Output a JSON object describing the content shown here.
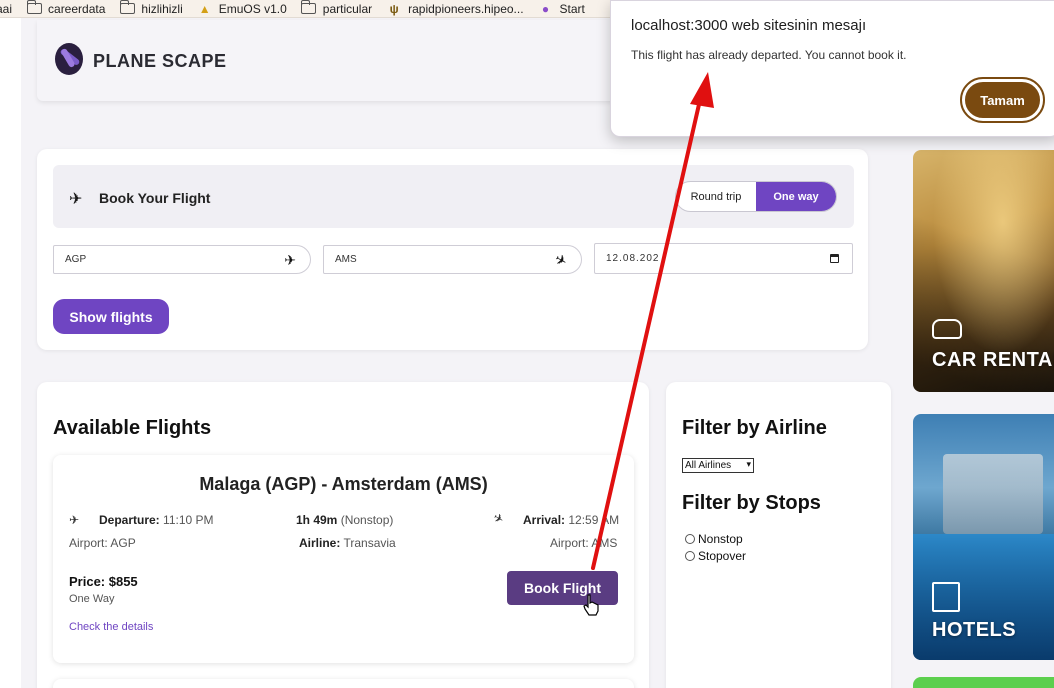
{
  "bookmarks": [
    {
      "label": "aai",
      "icon": "none"
    },
    {
      "label": "careerdata",
      "icon": "folder-icon"
    },
    {
      "label": "hizlihizli",
      "icon": "folder-icon"
    },
    {
      "label": "EmuOS v1.0",
      "icon": "emuos-icon"
    },
    {
      "label": "particular",
      "icon": "folder-icon"
    },
    {
      "label": "rapidpioneers.hipeo...",
      "icon": "rapidpioneers-icon"
    },
    {
      "label": "Start",
      "icon": "start-icon"
    }
  ],
  "header": {
    "brand": "PLANE SCAPE"
  },
  "booking": {
    "title": "Book Your Flight",
    "trip_types": [
      "Round trip",
      "One way"
    ],
    "active_trip_type": "One way",
    "from": "AGP",
    "to": "AMS",
    "date": "12.08.202",
    "show_button": "Show flights"
  },
  "flights": {
    "heading": "Available Flights",
    "items": [
      {
        "route": "Malaga (AGP) - Amsterdam (AMS)",
        "departure_label": "Departure:",
        "departure_time": "11:10 PM",
        "departure_airport": "Airport: AGP",
        "duration": "1h 49m",
        "stops": "(Nonstop)",
        "airline_label": "Airline:",
        "airline": "Transavia",
        "arrival_label": "Arrival:",
        "arrival_time": "12:59 AM",
        "arrival_airport": "Airport: AMS",
        "price": "Price: $855",
        "trip": "One Way",
        "details_link": "Check the details",
        "book_button": "Book Flight"
      }
    ]
  },
  "filters": {
    "airline_heading": "Filter by Airline",
    "airline_selected": "All Airlines",
    "stops_heading": "Filter by Stops",
    "stops_options": [
      "Nonstop",
      "Stopover"
    ]
  },
  "side": {
    "car_label": "CAR RENTAL",
    "hotels_label": "HOTELS"
  },
  "dialog": {
    "title": "localhost:3000 web sitesinin mesajı",
    "message": "This flight has already departed. You cannot book it.",
    "ok_button": "Tamam"
  },
  "colors": {
    "accent": "#6f45c2",
    "book_button": "#5a3c82",
    "dialog_button": "#7a4a10",
    "annotation_arrow": "#e01010"
  }
}
